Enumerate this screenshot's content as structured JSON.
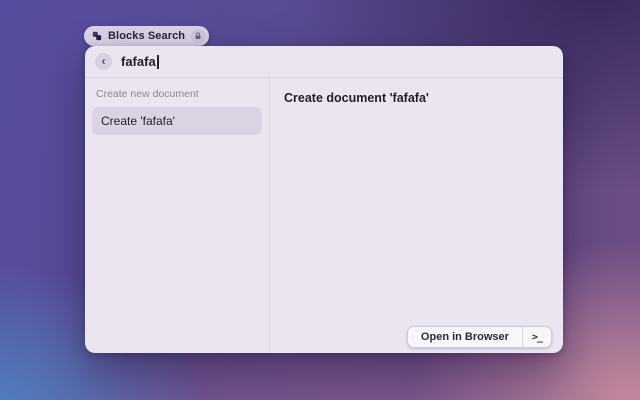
{
  "badge": {
    "label": "Blocks Search",
    "app_icon": "blocks-app-icon",
    "lock_icon": "lock-icon"
  },
  "search": {
    "value": "fafafa",
    "back_glyph": "‹"
  },
  "sidebar": {
    "section_header": "Create new document",
    "items": [
      {
        "label": "Create 'fafafa'",
        "selected": true
      }
    ]
  },
  "detail": {
    "title": "Create document 'fafafa'"
  },
  "footer": {
    "open_in_browser_label": "Open in Browser",
    "terminal_glyph": ">_"
  },
  "colors": {
    "window_background": "#eae5f1",
    "selection_background": "#d9d3e4",
    "divider": "#d8d2e2",
    "text_primary": "#211e29",
    "text_secondary": "#8b8798",
    "wallpaper_top_left": "#574da0",
    "wallpaper_top_right": "#35265a",
    "wallpaper_bottom_left": "#4d83c4",
    "wallpaper_bottom_right": "#c2879c"
  }
}
